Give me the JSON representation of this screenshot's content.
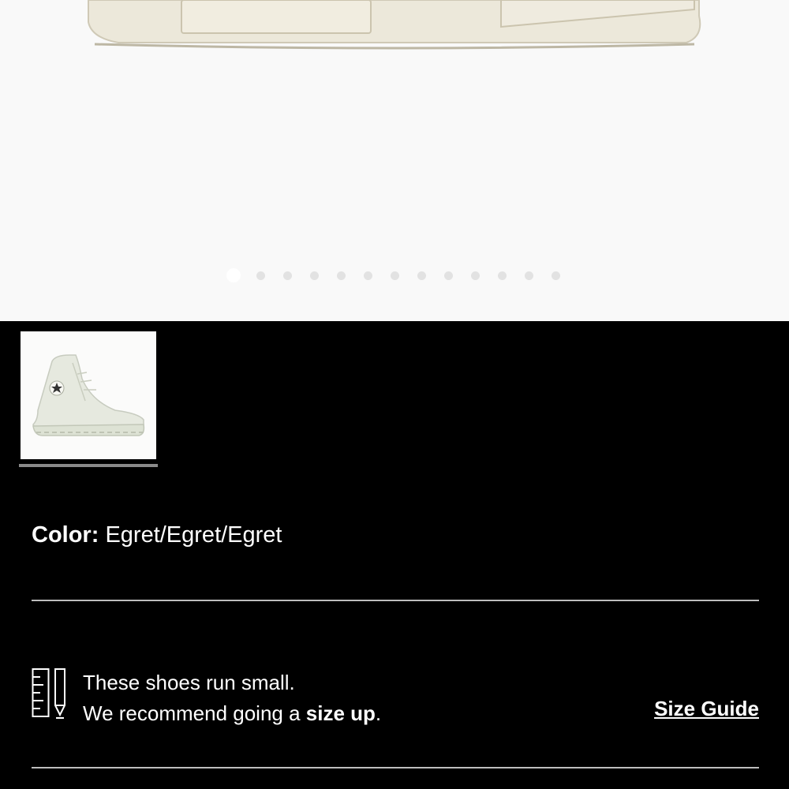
{
  "gallery": {
    "total_slides": 13,
    "active_index": 0,
    "thumbnails": [
      {
        "alt": "Egret high-top sneaker",
        "selected": true
      }
    ]
  },
  "product": {
    "color_label": "Color:",
    "color_value": "Egret/Egret/Egret"
  },
  "fit_note": {
    "line1": "These shoes run small.",
    "line2_prefix": "We recommend going a ",
    "line2_bold": "size up",
    "line2_suffix": ".",
    "icon": "ruler-pencil-icon"
  },
  "size_guide_label": "Size Guide",
  "colors": {
    "hero_bg": "#f9f9f9",
    "page_bg": "#000000",
    "divider": "#bdbdbd",
    "shoe_cream": "#ece8da"
  }
}
